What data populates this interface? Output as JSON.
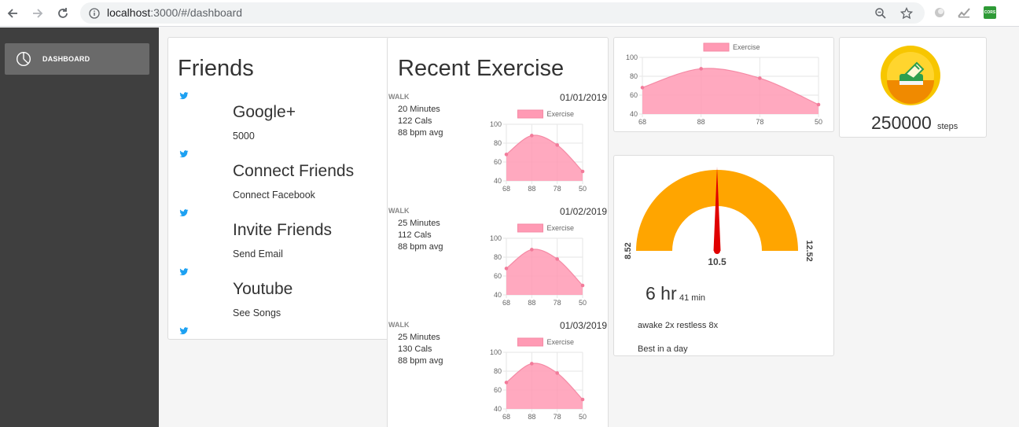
{
  "browser": {
    "url_host": "localhost",
    "url_path": ":3000/#/dashboard",
    "extensions": [
      "color-circle-icon",
      "chart-extension-icon",
      "cors-extension-icon"
    ],
    "cors_label": "CORS"
  },
  "sidebar": {
    "items": [
      {
        "label": "DASHBOARD",
        "icon": "pie-chart-icon"
      }
    ]
  },
  "friends": {
    "title": "Friends",
    "items": [
      {
        "name": "Google+",
        "sub": "5000"
      },
      {
        "name": "Connect Friends",
        "sub": "Connect Facebook"
      },
      {
        "name": "Invite Friends",
        "sub": "Send Email"
      },
      {
        "name": "Youtube",
        "sub": "See Songs"
      }
    ]
  },
  "exercise": {
    "title": "Recent Exercise",
    "entries": [
      {
        "type": "WALK",
        "date": "01/01/2019",
        "duration": "20 Minutes",
        "cals": "122 Cals",
        "bpm": "88 bpm avg"
      },
      {
        "type": "WALK",
        "date": "01/02/2019",
        "duration": "25 Minutes",
        "cals": "112 Cals",
        "bpm": "88 bpm avg"
      },
      {
        "type": "WALK",
        "date": "01/03/2019",
        "duration": "25 Minutes",
        "cals": "130 Cals",
        "bpm": "88 bpm avg"
      }
    ]
  },
  "chart_data": {
    "type": "area",
    "categories": [
      "68",
      "88",
      "78",
      "50"
    ],
    "series": [
      {
        "name": "Exercise",
        "values": [
          68,
          88,
          78,
          50
        ]
      }
    ],
    "ylim": [
      40,
      100
    ],
    "yticks": [
      40,
      60,
      80,
      100
    ],
    "legend": "top",
    "grid": true,
    "color": "#ff9ab4"
  },
  "steps": {
    "value": "250000",
    "unit": "steps"
  },
  "sleep": {
    "gauge_min": "8.52",
    "gauge_max": "12.52",
    "gauge_value": "10.5",
    "gauge_color": "#ffa500",
    "needle_color": "#e00000",
    "hours": "6 hr",
    "minutes": "41 min",
    "detail": "awake 2x restless 8x",
    "best": "Best in a day"
  }
}
